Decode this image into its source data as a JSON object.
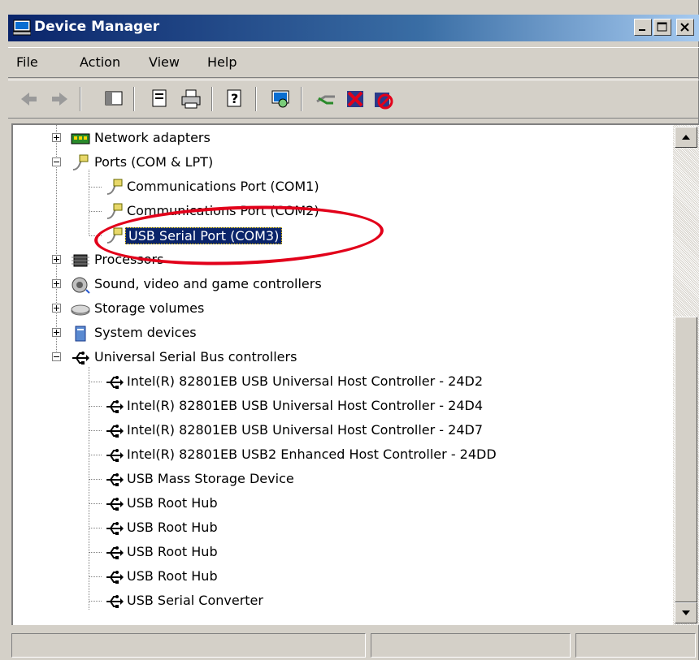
{
  "window": {
    "title": "Device Manager",
    "buttons": [
      "minimize-icon",
      "restore-icon",
      "close-icon"
    ]
  },
  "menu": [
    "File",
    "Action",
    "View",
    "Help"
  ],
  "toolbar": [
    "back-arrow-icon",
    "forward-arrow-icon",
    "console-tree-icon",
    "properties-icon",
    "print-icon",
    "help-icon",
    "scan-hardware-icon",
    "update-driver-icon",
    "uninstall-icon",
    "disable-icon"
  ],
  "tree": {
    "network_adapters": "Network adapters",
    "ports": "Ports (COM & LPT)",
    "com1": "Communications Port (COM1)",
    "com2": "Communications Port (COM2)",
    "com3": "USB Serial Port (COM3)",
    "processors": "Processors",
    "sound": "Sound, video and game controllers",
    "storage": "Storage volumes",
    "system": "System devices",
    "usb_controllers": "Universal Serial Bus controllers",
    "usb_children": [
      "Intel(R) 82801EB USB Universal Host Controller - 24D2",
      "Intel(R) 82801EB USB Universal Host Controller - 24D4",
      "Intel(R) 82801EB USB Universal Host Controller - 24D7",
      "Intel(R) 82801EB USB2 Enhanced Host Controller - 24DD",
      "USB Mass Storage Device",
      "USB Root Hub",
      "USB Root Hub",
      "USB Root Hub",
      "USB Root Hub",
      "USB Serial Converter"
    ]
  },
  "highlight_color": "#e2001a",
  "selection_color": "#0a246a"
}
